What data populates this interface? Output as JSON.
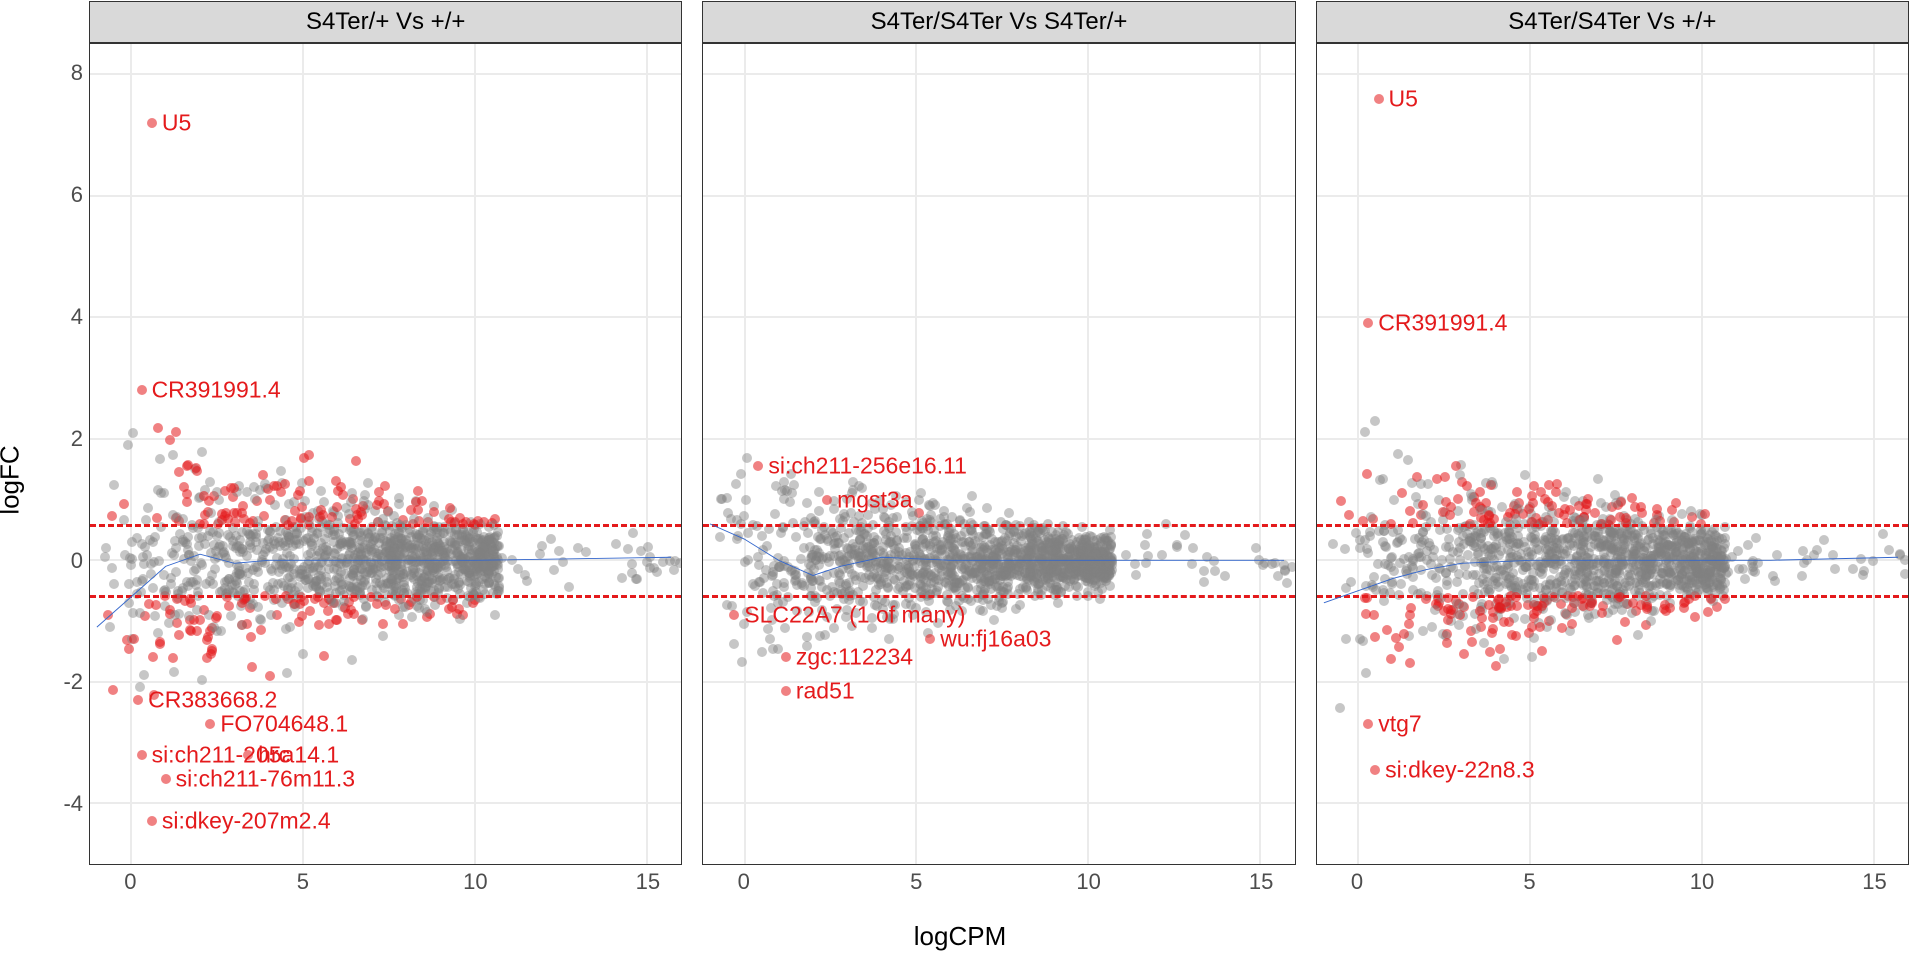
{
  "xlabel": "logCPM",
  "ylabel": "logFC",
  "x_range": [
    -1.2,
    16.0
  ],
  "y_range": [
    -5.0,
    8.5
  ],
  "x_ticks": [
    0,
    5,
    10,
    15
  ],
  "y_ticks": [
    -4,
    -2,
    0,
    2,
    4,
    6,
    8
  ],
  "hline_at": [
    0.58,
    -0.58
  ],
  "chart_data": [
    {
      "type": "scatter",
      "title": "S4Ter/+ Vs +/+",
      "xlabel": "logCPM",
      "ylabel": "logFC",
      "smooth": [
        {
          "x": -1.0,
          "y": -1.1
        },
        {
          "x": 0.0,
          "y": -0.6
        },
        {
          "x": 1.0,
          "y": -0.1
        },
        {
          "x": 2.0,
          "y": 0.1
        },
        {
          "x": 3.0,
          "y": -0.05
        },
        {
          "x": 4.0,
          "y": 0.0
        },
        {
          "x": 6.0,
          "y": 0.0
        },
        {
          "x": 10.0,
          "y": 0.0
        },
        {
          "x": 15.7,
          "y": 0.05
        }
      ],
      "labels": [
        {
          "text": "U5",
          "x": 0.6,
          "y": 7.2
        },
        {
          "text": "CR391991.4",
          "x": 0.3,
          "y": 2.8
        },
        {
          "text": "CR383668.2",
          "x": 0.2,
          "y": -2.3
        },
        {
          "text": "FO704648.1",
          "x": 2.3,
          "y": -2.7
        },
        {
          "text": "si:ch211-205a14.1",
          "x": 0.3,
          "y": -3.2
        },
        {
          "text": "hrc",
          "x": 3.4,
          "y": -3.2
        },
        {
          "text": "si:ch211-76m11.3",
          "x": 1.0,
          "y": -3.6
        },
        {
          "text": "si:dkey-207m2.4",
          "x": 0.6,
          "y": -4.3
        }
      ]
    },
    {
      "type": "scatter",
      "title": "S4Ter/S4Ter Vs S4Ter/+",
      "xlabel": "logCPM",
      "ylabel": "logFC",
      "smooth": [
        {
          "x": -1.0,
          "y": 0.6
        },
        {
          "x": 0.0,
          "y": 0.35
        },
        {
          "x": 1.0,
          "y": 0.0
        },
        {
          "x": 2.0,
          "y": -0.25
        },
        {
          "x": 2.8,
          "y": -0.1
        },
        {
          "x": 4.0,
          "y": 0.05
        },
        {
          "x": 6.0,
          "y": 0.0
        },
        {
          "x": 10.0,
          "y": 0.0
        },
        {
          "x": 15.7,
          "y": 0.0
        }
      ],
      "labels": [
        {
          "text": "si:ch211-256e16.11",
          "x": 0.4,
          "y": 1.55
        },
        {
          "text": "mgst3a",
          "x": 2.4,
          "y": 1.0
        },
        {
          "text": "SLC22A7 (1 of many)",
          "x": -0.3,
          "y": -0.9
        },
        {
          "text": "wu:fj16a03",
          "x": 5.4,
          "y": -1.3
        },
        {
          "text": "zgc:112234",
          "x": 1.2,
          "y": -1.6
        },
        {
          "text": "rad51",
          "x": 1.2,
          "y": -2.15
        }
      ]
    },
    {
      "type": "scatter",
      "title": "S4Ter/S4Ter Vs +/+",
      "xlabel": "logCPM",
      "ylabel": "logFC",
      "smooth": [
        {
          "x": -1.0,
          "y": -0.7
        },
        {
          "x": 0.0,
          "y": -0.5
        },
        {
          "x": 1.0,
          "y": -0.3
        },
        {
          "x": 2.0,
          "y": -0.15
        },
        {
          "x": 3.0,
          "y": -0.05
        },
        {
          "x": 5.0,
          "y": 0.0
        },
        {
          "x": 8.0,
          "y": 0.0
        },
        {
          "x": 12.0,
          "y": 0.0
        },
        {
          "x": 15.7,
          "y": 0.05
        }
      ],
      "labels": [
        {
          "text": "U5",
          "x": 0.6,
          "y": 7.6
        },
        {
          "text": "CR391991.4",
          "x": 0.3,
          "y": 3.9
        },
        {
          "text": "vtg7",
          "x": 0.3,
          "y": -2.7
        },
        {
          "text": "si:dkey-22n8.3",
          "x": 0.5,
          "y": -3.45
        }
      ]
    }
  ]
}
